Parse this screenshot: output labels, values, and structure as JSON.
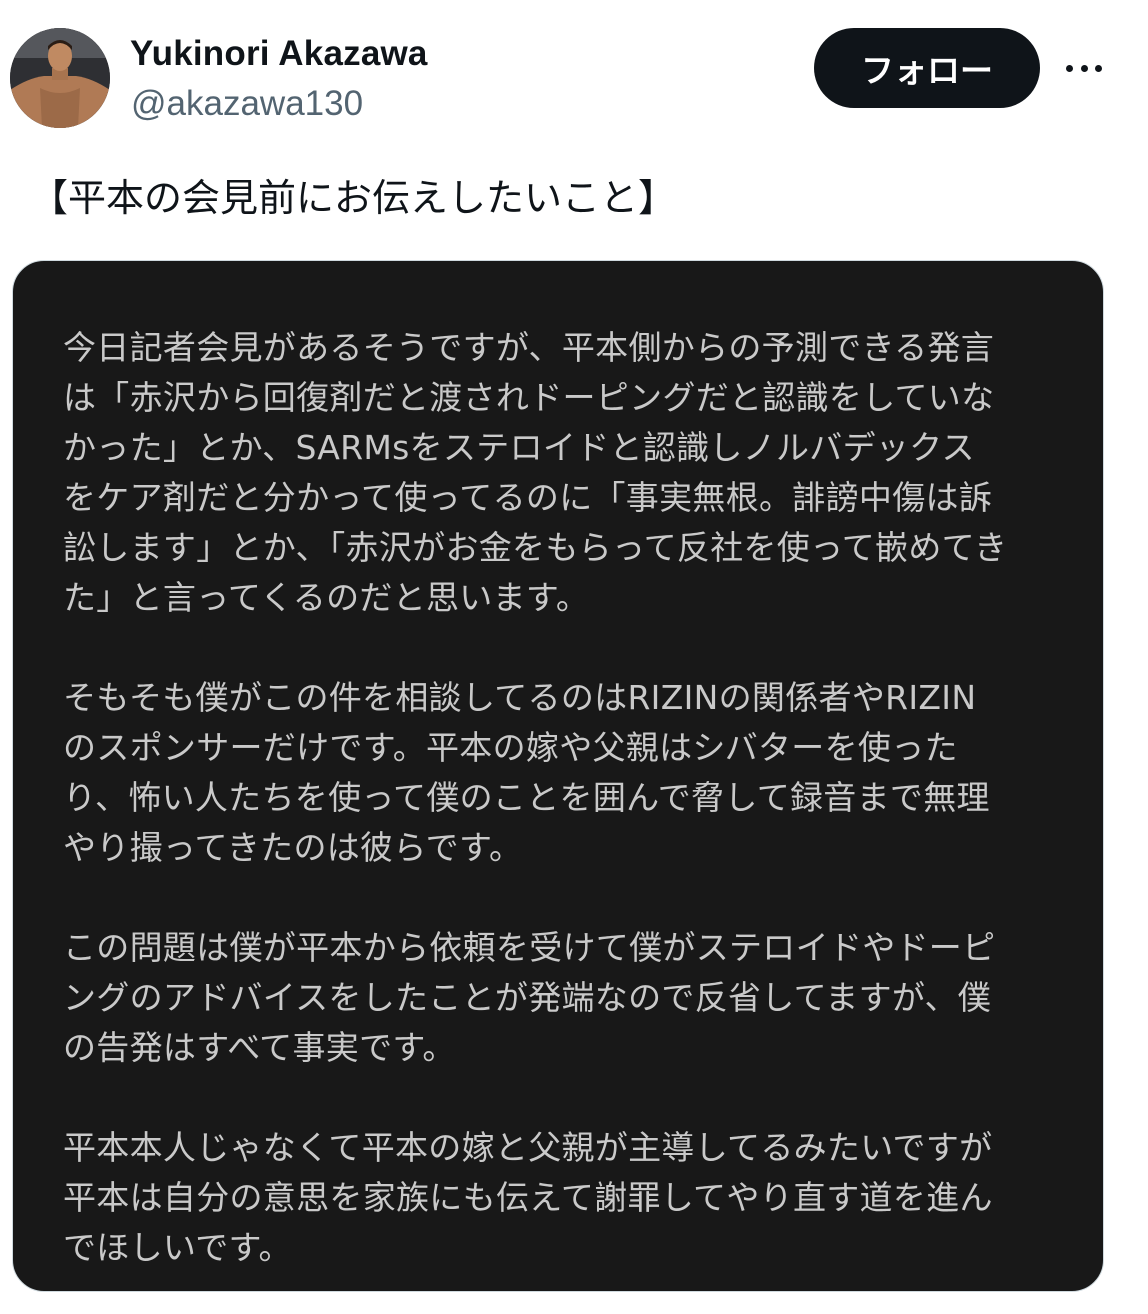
{
  "author": {
    "name": "Yukinori Akazawa",
    "handle": "@akazawa130"
  },
  "actions": {
    "follow_label": "フォロー",
    "more_icon": "more-horizontal-icon"
  },
  "tweet": {
    "text": "【平本の会見前にお伝えしたいこと】"
  },
  "image_text": {
    "paragraphs": [
      {
        "lines": [
          "今日記者会見があるそうですが、平本側からの予測できる発言",
          "は「赤沢から回復剤だと渡されドーピングだと認識をしていな",
          "かった」とか、SARMsをステロイドと認識しノルバデックス",
          "をケア剤だと分かって使ってるのに「事実無根。誹謗中傷は訴",
          "訟します」とか、「赤沢がお金をもらって反社を使って嵌めてき",
          "た」と言ってくるのだと思います。"
        ]
      },
      {
        "lines": [
          "そもそも僕がこの件を相談してるのはRIZINの関係者やRIZIN",
          "のスポンサーだけです。平本の嫁や父親はシバターを使った",
          "り、怖い人たちを使って僕のことを囲んで脅して録音まで無理",
          "やり撮ってきたのは彼らです。"
        ]
      },
      {
        "lines": [
          "この問題は僕が平本から依頼を受けて僕がステロイドやドーピ",
          "ングのアドバイスをしたことが発端なので反省してますが、僕",
          "の告発はすべて事実です。"
        ]
      },
      {
        "lines": [
          "平本本人じゃなくて平本の嫁と父親が主導してるみたいですが",
          "平本は自分の意思を家族にも伝えて謝罪してやり直す道を進ん",
          "でほしいです。"
        ]
      }
    ]
  },
  "colors": {
    "text_primary": "#0f1419",
    "text_secondary": "#536471",
    "follow_bg": "#0f1419",
    "card_bg": "#181818",
    "card_text": "#c9c9c9"
  }
}
